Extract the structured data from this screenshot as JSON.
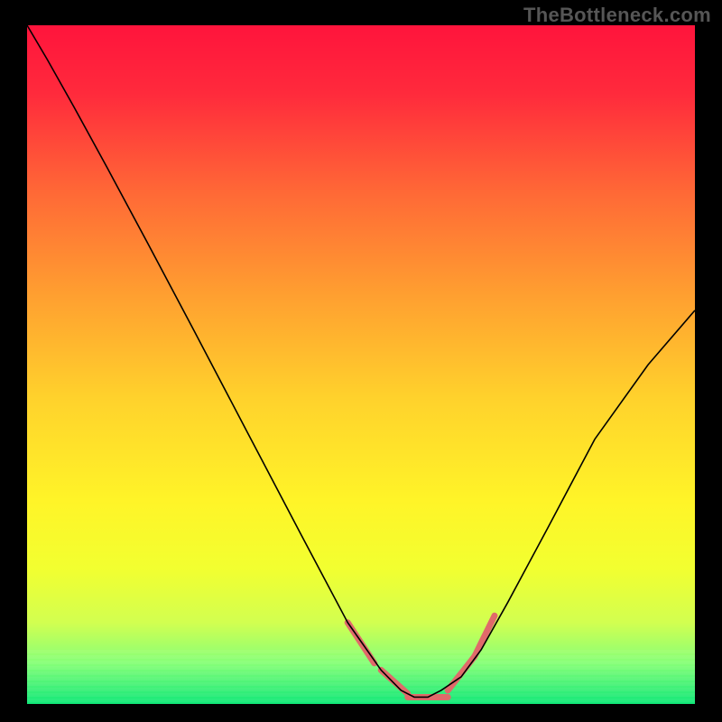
{
  "watermark": "TheBottleneck.com",
  "chart_data": {
    "type": "line",
    "title": "",
    "xlabel": "",
    "ylabel": "",
    "xlim": [
      0,
      100
    ],
    "ylim": [
      0,
      100
    ],
    "grid": false,
    "legend": false,
    "background": {
      "type": "vertical-gradient",
      "stops": [
        {
          "pos": 0.0,
          "color": "#ff143c"
        },
        {
          "pos": 0.1,
          "color": "#ff2a3c"
        },
        {
          "pos": 0.25,
          "color": "#ff6a36"
        },
        {
          "pos": 0.4,
          "color": "#ffa030"
        },
        {
          "pos": 0.55,
          "color": "#ffd22c"
        },
        {
          "pos": 0.7,
          "color": "#fff428"
        },
        {
          "pos": 0.8,
          "color": "#f2ff30"
        },
        {
          "pos": 0.88,
          "color": "#d2ff50"
        },
        {
          "pos": 0.94,
          "color": "#86ff78"
        },
        {
          "pos": 1.0,
          "color": "#10e878"
        }
      ]
    },
    "series": [
      {
        "name": "bottleneck-curve",
        "color": "#000000",
        "width": 1.6,
        "x": [
          0,
          3,
          7,
          12,
          18,
          25,
          33,
          41,
          48,
          53,
          56,
          58,
          60,
          62,
          65,
          68,
          72,
          78,
          85,
          93,
          100
        ],
        "y": [
          100,
          95,
          88,
          79,
          68,
          55,
          40,
          25,
          12,
          5,
          2,
          1,
          1,
          2,
          4,
          8,
          15,
          26,
          39,
          50,
          58
        ]
      }
    ],
    "annotations": [
      {
        "name": "valley-highlight",
        "type": "segments",
        "color": "#e06a6a",
        "width": 7,
        "segments": [
          {
            "x1": 48,
            "y1": 12,
            "x2": 52,
            "y2": 6
          },
          {
            "x1": 53,
            "y1": 5,
            "x2": 57,
            "y2": 1.5
          },
          {
            "x1": 57,
            "y1": 1,
            "x2": 63,
            "y2": 1
          },
          {
            "x1": 63,
            "y1": 2,
            "x2": 67,
            "y2": 7
          },
          {
            "x1": 67,
            "y1": 7,
            "x2": 70,
            "y2": 13
          }
        ]
      }
    ]
  }
}
